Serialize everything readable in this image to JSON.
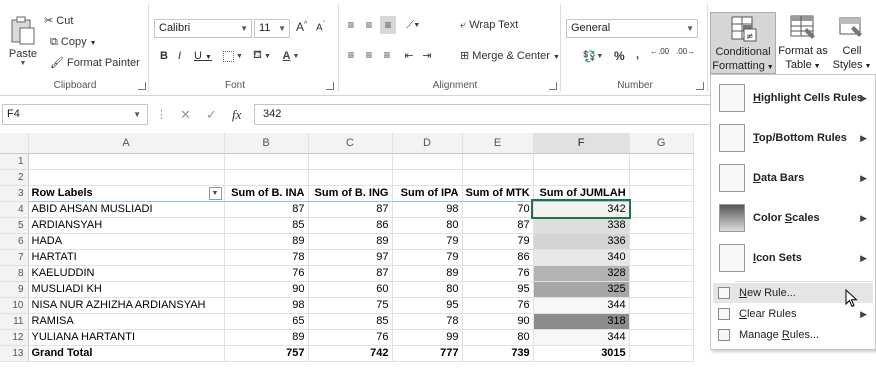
{
  "ribbon": {
    "clipboard": {
      "paste": "Paste",
      "cut": "Cut",
      "copy": "Copy",
      "format_painter": "Format Painter",
      "group_label": "Clipboard"
    },
    "font": {
      "font_name": "Calibri",
      "font_size": "11",
      "bold": "B",
      "italic": "I",
      "underline": "U",
      "grow": "A",
      "shrink": "A",
      "font_color": "A",
      "group_label": "Font"
    },
    "alignment": {
      "wrap_text": "Wrap Text",
      "merge_center": "Merge & Center",
      "group_label": "Alignment"
    },
    "number": {
      "format": "General",
      "percent": "%",
      "comma": ",",
      "inc_decimal": ".00",
      "dec_decimal": ".00",
      "group_label": "Number"
    },
    "styles": {
      "conditional_formatting": "Conditional Formatting",
      "conditional_formatting_line1": "Conditional",
      "conditional_formatting_line2": "Formatting",
      "format_as_table_line1": "Format as",
      "format_as_table_line2": "Table",
      "cell_styles_line1": "Cell",
      "cell_styles_line2": "Styles"
    }
  },
  "formula_bar": {
    "name_box": "F4",
    "fx": "fx",
    "value": "342"
  },
  "sheet": {
    "columns": [
      "",
      "A",
      "B",
      "C",
      "D",
      "E",
      "F",
      "G"
    ],
    "header_row": {
      "row_labels": "Row Labels",
      "b_ina": "Sum of B. INA",
      "b_ing": "Sum of B. ING",
      "ipa": "Sum of IPA",
      "mtk": "Sum of MTK",
      "jumlah": "Sum of JUMLAH"
    },
    "rows": [
      {
        "num": "4",
        "name": "ABID AHSAN MUSLIADI",
        "b_ina": "87",
        "b_ing": "87",
        "ipa": "98",
        "mtk": "70",
        "jumlah": "342",
        "fill": "#f2f2f2"
      },
      {
        "num": "5",
        "name": "ARDIANSYAH",
        "b_ina": "85",
        "b_ing": "86",
        "ipa": "80",
        "mtk": "87",
        "jumlah": "338",
        "fill": "#dedede"
      },
      {
        "num": "6",
        "name": "HADA",
        "b_ina": "89",
        "b_ing": "89",
        "ipa": "79",
        "mtk": "79",
        "jumlah": "336",
        "fill": "#d4d4d4"
      },
      {
        "num": "7",
        "name": "HARTATI",
        "b_ina": "78",
        "b_ing": "97",
        "ipa": "79",
        "mtk": "86",
        "jumlah": "340",
        "fill": "#e8e8e8"
      },
      {
        "num": "8",
        "name": "KAELUDDIN",
        "b_ina": "76",
        "b_ing": "87",
        "ipa": "89",
        "mtk": "76",
        "jumlah": "328",
        "fill": "#b3b3b3"
      },
      {
        "num": "9",
        "name": "MUSLIADI KH",
        "b_ina": "90",
        "b_ing": "60",
        "ipa": "80",
        "mtk": "95",
        "jumlah": "325",
        "fill": "#a6a6a6"
      },
      {
        "num": "10",
        "name": "NISA NUR AZHIZHA ARDIANSYAH",
        "b_ina": "98",
        "b_ing": "75",
        "ipa": "95",
        "mtk": "76",
        "jumlah": "344",
        "fill": "#f7f7f7"
      },
      {
        "num": "11",
        "name": "RAMISA",
        "b_ina": "65",
        "b_ing": "85",
        "ipa": "78",
        "mtk": "90",
        "jumlah": "318",
        "fill": "#8c8c8c"
      },
      {
        "num": "12",
        "name": "YULIANA HARTANTI",
        "b_ina": "89",
        "b_ing": "76",
        "ipa": "99",
        "mtk": "80",
        "jumlah": "344",
        "fill": "#f7f7f7"
      }
    ],
    "total": {
      "num": "13",
      "name": "Grand Total",
      "b_ina": "757",
      "b_ing": "742",
      "ipa": "777",
      "mtk": "739",
      "jumlah": "3015"
    },
    "row_numbers": {
      "r1": "1",
      "r2": "2",
      "r3": "3"
    }
  },
  "cf_menu": {
    "highlight": {
      "pre": "",
      "key": "H",
      "post": "ighlight Cells Rules"
    },
    "topbottom": {
      "pre": "",
      "key": "T",
      "post": "op/Bottom Rules"
    },
    "databars": {
      "pre": "",
      "key": "D",
      "post": "ata Bars"
    },
    "colorscales": {
      "pre": "Color ",
      "key": "S",
      "post": "cales"
    },
    "iconsets": {
      "pre": "",
      "key": "I",
      "post": "con Sets"
    },
    "newrule": {
      "pre": "",
      "key": "N",
      "post": "ew Rule..."
    },
    "clearrules": {
      "pre": "",
      "key": "C",
      "post": "lear Rules"
    },
    "managerules": {
      "pre": "Manage ",
      "key": "R",
      "post": "ules..."
    }
  }
}
